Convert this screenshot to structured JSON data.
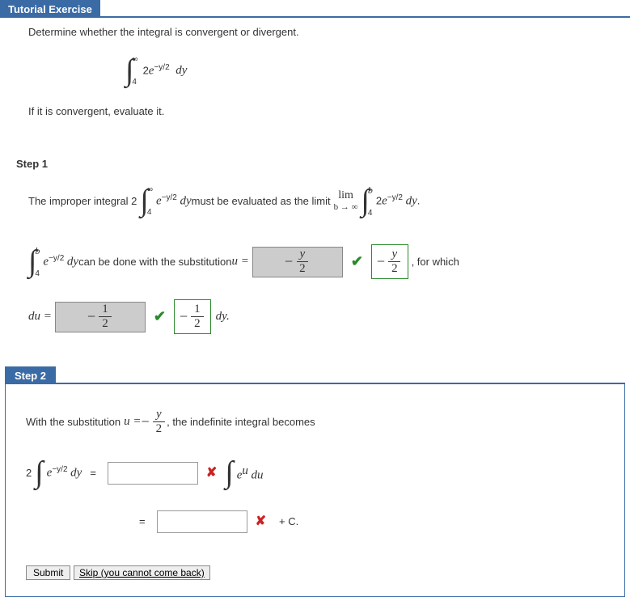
{
  "header": {
    "title": "Tutorial Exercise"
  },
  "problem": {
    "prompt": "Determine whether the integral is convergent or divergent.",
    "integral": {
      "lower": "4",
      "upper": "∞",
      "integrand_coeff": "2",
      "exp": "−y/2",
      "diff": "dy"
    },
    "instruction": "If it is convergent, evaluate it."
  },
  "step1": {
    "title": "Step 1",
    "line1_a": "The improper integral 2",
    "line1_int": {
      "lower": "4",
      "upper": "∞",
      "exp": "−y/2",
      "diff": "dy"
    },
    "line1_b": " must be evaluated as the limit ",
    "limit_top": "lim",
    "limit_bot": "b → ∞",
    "line1_int2": {
      "lower": "4",
      "upper": "b",
      "coeff": "2",
      "exp": "−y/2",
      "diff": "dy"
    },
    "line2_int": {
      "lower": "4",
      "upper": "b",
      "exp": "−y/2",
      "diff": "dy"
    },
    "line2_a": " can be done with the substitution ",
    "u_eq": "u =",
    "answer1_neg": "−",
    "answer1_num": "y",
    "answer1_den": "2",
    "correct_neg": "−",
    "correct_num": "y",
    "correct_den": "2",
    "for_which": ", for which",
    "du_eq": "du =",
    "answer2_neg": "−",
    "answer2_num": "1",
    "answer2_den": "2",
    "du_correct_neg": "−",
    "du_correct_num": "1",
    "du_correct_den": "2",
    "dy_suffix": "dy."
  },
  "step2": {
    "title": "Step 2",
    "line1_a": "With the substitution ",
    "u_eq": "u = ",
    "sub_neg": "−",
    "sub_num": "y",
    "sub_den": "2",
    "line1_b": ", the indefinite integral becomes",
    "lhs_coeff": "2",
    "lhs_exp": "−y/2",
    "lhs_diff": "dy",
    "eq": "=",
    "rhs_exp": "u",
    "rhs_diff": "du",
    "plus_c": "+ C.",
    "submit": "Submit",
    "skip": "Skip (you cannot come back)"
  }
}
